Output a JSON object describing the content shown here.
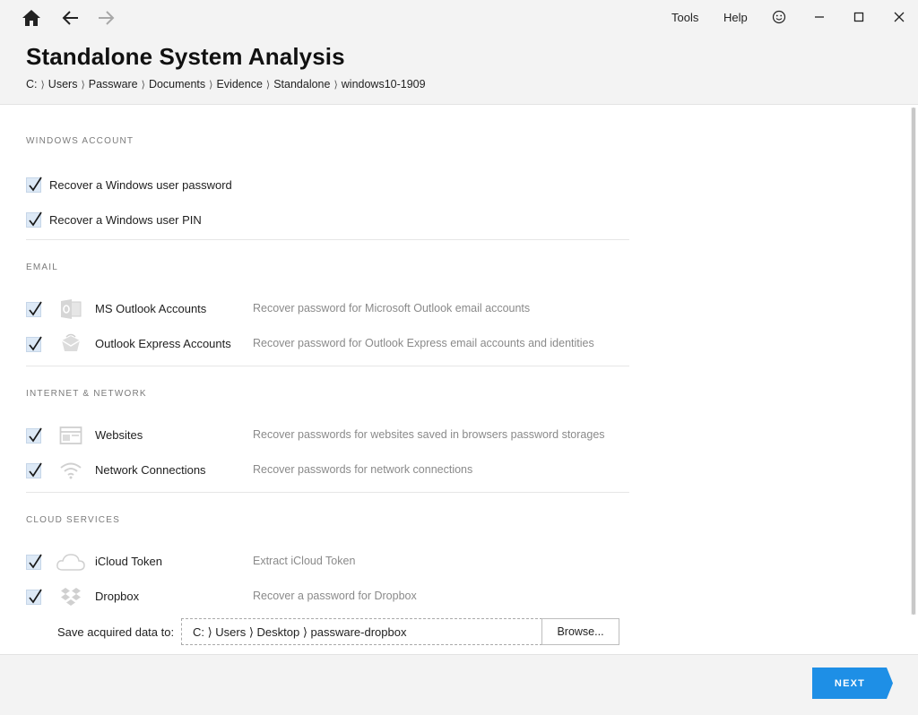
{
  "nav": {
    "home_icon": "home-icon",
    "back_icon": "arrow-left-icon",
    "forward_icon": "arrow-right-icon"
  },
  "menu": {
    "tools": "Tools",
    "help": "Help",
    "feedback_icon": "smiley-icon"
  },
  "window": {
    "minimize_icon": "minimize-icon",
    "maximize_icon": "maximize-icon",
    "close_icon": "close-icon"
  },
  "page": {
    "title": "Standalone System Analysis",
    "breadcrumb": [
      "C:",
      "Users",
      "Passware",
      "Documents",
      "Evidence",
      "Standalone",
      "windows10-1909"
    ]
  },
  "sections": {
    "windows": {
      "title": "WINDOWS ACCOUNT",
      "items": [
        {
          "label": "Recover a Windows user password",
          "checked": true
        },
        {
          "label": "Recover a Windows user PIN",
          "checked": true
        }
      ]
    },
    "email": {
      "title": "EMAIL",
      "items": [
        {
          "name": "MS Outlook Accounts",
          "desc": "Recover password for Microsoft Outlook email accounts",
          "icon": "outlook-icon",
          "checked": true
        },
        {
          "name": "Outlook Express Accounts",
          "desc": "Recover password for Outlook Express email accounts and identities",
          "icon": "outlook-express-icon",
          "checked": true
        }
      ]
    },
    "internet": {
      "title": "INTERNET & NETWORK",
      "items": [
        {
          "name": "Websites",
          "desc": "Recover passwords for websites saved in browsers password storages",
          "icon": "browser-window-icon",
          "checked": true
        },
        {
          "name": "Network Connections",
          "desc": "Recover passwords for network connections",
          "icon": "wifi-icon",
          "checked": true
        }
      ]
    },
    "cloud": {
      "title": "CLOUD SERVICES",
      "items": [
        {
          "name": "iCloud Token",
          "desc": "Extract iCloud Token",
          "icon": "cloud-icon",
          "checked": true
        },
        {
          "name": "Dropbox",
          "desc": "Recover a password for Dropbox",
          "icon": "dropbox-icon",
          "checked": true
        }
      ]
    }
  },
  "save": {
    "label": "Save acquired data to:",
    "path": "C: ⟩ Users ⟩ Desktop ⟩ passware-dropbox",
    "browse": "Browse..."
  },
  "footer": {
    "next": "NEXT",
    "accent": "#1e8fe6"
  }
}
